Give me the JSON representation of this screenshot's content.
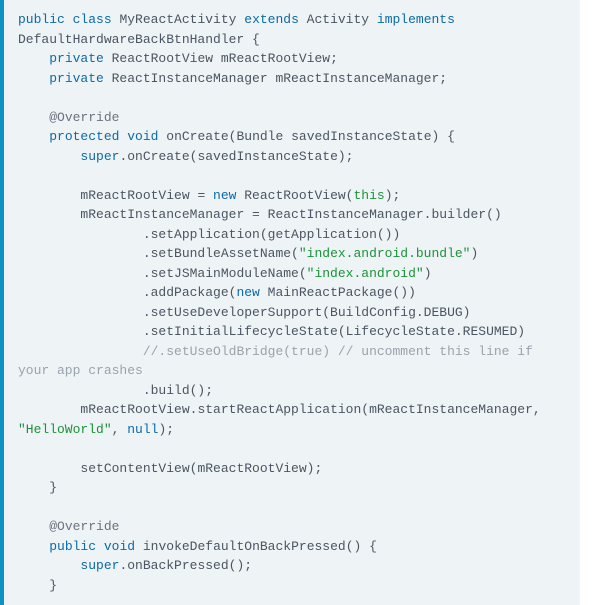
{
  "code": {
    "tokens": [
      {
        "t": "kw",
        "v": "public"
      },
      {
        "t": "base",
        "v": " "
      },
      {
        "t": "kw",
        "v": "class"
      },
      {
        "t": "base",
        "v": " MyReactActivity "
      },
      {
        "t": "kw",
        "v": "extends"
      },
      {
        "t": "base",
        "v": " Activity "
      },
      {
        "t": "kw",
        "v": "implements"
      },
      {
        "t": "base",
        "v": " DefaultHardwareBackBtnHandler {\n"
      },
      {
        "t": "base",
        "v": "    "
      },
      {
        "t": "kw",
        "v": "private"
      },
      {
        "t": "base",
        "v": " ReactRootView mReactRootView;\n"
      },
      {
        "t": "base",
        "v": "    "
      },
      {
        "t": "kw",
        "v": "private"
      },
      {
        "t": "base",
        "v": " ReactInstanceManager mReactInstanceManager;\n"
      },
      {
        "t": "base",
        "v": "\n"
      },
      {
        "t": "base",
        "v": "    "
      },
      {
        "t": "annot",
        "v": "@Override"
      },
      {
        "t": "base",
        "v": "\n"
      },
      {
        "t": "base",
        "v": "    "
      },
      {
        "t": "kw",
        "v": "protected"
      },
      {
        "t": "base",
        "v": " "
      },
      {
        "t": "kw",
        "v": "void"
      },
      {
        "t": "base",
        "v": " onCreate(Bundle savedInstanceState) {\n"
      },
      {
        "t": "base",
        "v": "        "
      },
      {
        "t": "kw",
        "v": "super"
      },
      {
        "t": "base",
        "v": ".onCreate(savedInstanceState);\n"
      },
      {
        "t": "base",
        "v": "\n"
      },
      {
        "t": "base",
        "v": "        mReactRootView = "
      },
      {
        "t": "kw",
        "v": "new"
      },
      {
        "t": "base",
        "v": " ReactRootView("
      },
      {
        "t": "this",
        "v": "this"
      },
      {
        "t": "base",
        "v": ");\n"
      },
      {
        "t": "base",
        "v": "        mReactInstanceManager = ReactInstanceManager.builder()\n"
      },
      {
        "t": "base",
        "v": "                .setApplication(getApplication())\n"
      },
      {
        "t": "base",
        "v": "                .setBundleAssetName("
      },
      {
        "t": "str",
        "v": "\"index.android.bundle\""
      },
      {
        "t": "base",
        "v": ")\n"
      },
      {
        "t": "base",
        "v": "                .setJSMainModuleName("
      },
      {
        "t": "str",
        "v": "\"index.android\""
      },
      {
        "t": "base",
        "v": ")\n"
      },
      {
        "t": "base",
        "v": "                .addPackage("
      },
      {
        "t": "kw",
        "v": "new"
      },
      {
        "t": "base",
        "v": " MainReactPackage())\n"
      },
      {
        "t": "base",
        "v": "                .setUseDeveloperSupport(BuildConfig.DEBUG)\n"
      },
      {
        "t": "base",
        "v": "                .setInitialLifecycleState(LifecycleState.RESUMED)\n"
      },
      {
        "t": "base",
        "v": "                "
      },
      {
        "t": "comment",
        "v": "//.setUseOldBridge(true) // uncomment this line if your app crashes"
      },
      {
        "t": "base",
        "v": "\n"
      },
      {
        "t": "base",
        "v": "                .build();\n"
      },
      {
        "t": "base",
        "v": "        mReactRootView.startReactApplication(mReactInstanceManager, "
      },
      {
        "t": "str",
        "v": "\"HelloWorld\""
      },
      {
        "t": "base",
        "v": ", "
      },
      {
        "t": "null",
        "v": "null"
      },
      {
        "t": "base",
        "v": ");\n"
      },
      {
        "t": "base",
        "v": "\n"
      },
      {
        "t": "base",
        "v": "        setContentView(mReactRootView);\n"
      },
      {
        "t": "base",
        "v": "    }\n"
      },
      {
        "t": "base",
        "v": "\n"
      },
      {
        "t": "base",
        "v": "    "
      },
      {
        "t": "annot",
        "v": "@Override"
      },
      {
        "t": "base",
        "v": "\n"
      },
      {
        "t": "base",
        "v": "    "
      },
      {
        "t": "kw",
        "v": "public"
      },
      {
        "t": "base",
        "v": " "
      },
      {
        "t": "kw",
        "v": "void"
      },
      {
        "t": "base",
        "v": " invokeDefaultOnBackPressed() {\n"
      },
      {
        "t": "base",
        "v": "        "
      },
      {
        "t": "kw",
        "v": "super"
      },
      {
        "t": "base",
        "v": ".onBackPressed();\n"
      },
      {
        "t": "base",
        "v": "    }\n"
      }
    ]
  }
}
